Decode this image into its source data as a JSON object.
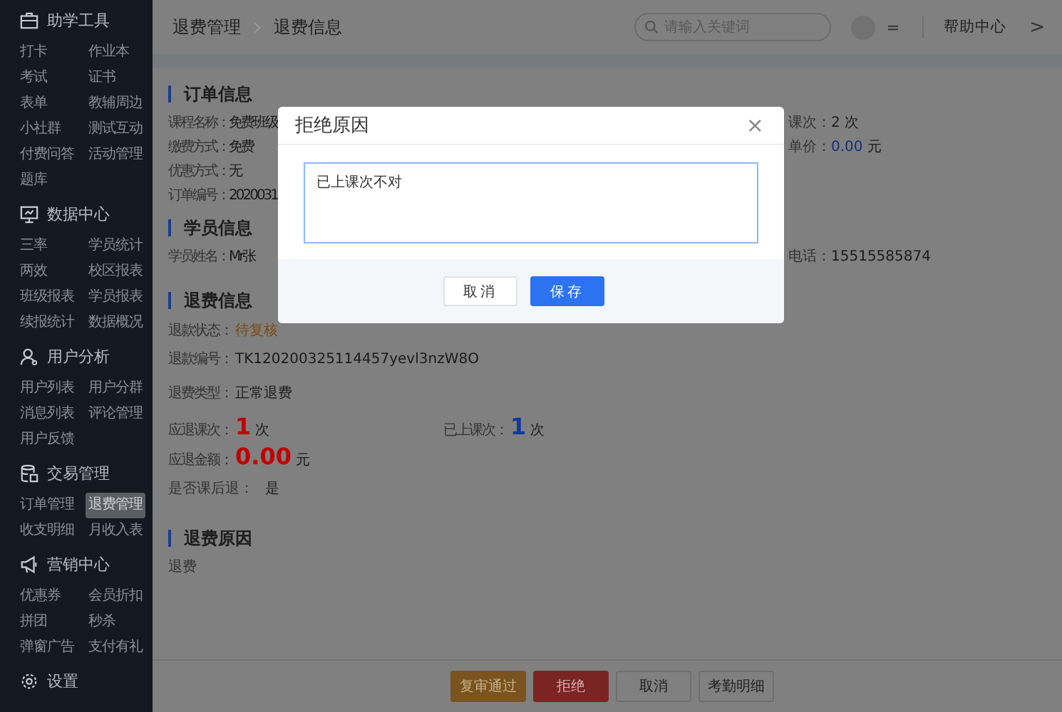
{
  "sidebar": {
    "groups": [
      {
        "title": "助学工具",
        "items": [
          {
            "label": "打卡",
            "selected": false
          },
          {
            "label": "作业本",
            "selected": false
          },
          {
            "label": "考试",
            "selected": false
          },
          {
            "label": "证书",
            "selected": false
          },
          {
            "label": "表单",
            "selected": false
          },
          {
            "label": "教辅周边",
            "selected": false
          },
          {
            "label": "小社群",
            "selected": false
          },
          {
            "label": "测试互动",
            "selected": false
          },
          {
            "label": "付费问答",
            "selected": false
          },
          {
            "label": "活动管理",
            "selected": false
          },
          {
            "label": "题库",
            "selected": false
          }
        ]
      },
      {
        "title": "数据中心",
        "items": [
          {
            "label": "三率",
            "selected": false
          },
          {
            "label": "学员统计",
            "selected": false
          },
          {
            "label": "两效",
            "selected": false
          },
          {
            "label": "校区报表",
            "selected": false
          },
          {
            "label": "班级报表",
            "selected": false
          },
          {
            "label": "学员报表",
            "selected": false
          },
          {
            "label": "续报统计",
            "selected": false
          },
          {
            "label": "数据概况",
            "selected": false
          }
        ]
      },
      {
        "title": "用户分析",
        "items": [
          {
            "label": "用户列表",
            "selected": false
          },
          {
            "label": "用户分群",
            "selected": false
          },
          {
            "label": "消息列表",
            "selected": false
          },
          {
            "label": "评论管理",
            "selected": false
          },
          {
            "label": "用户反馈",
            "selected": false
          }
        ]
      },
      {
        "title": "交易管理",
        "items": [
          {
            "label": "订单管理",
            "selected": false
          },
          {
            "label": "退费管理",
            "selected": true
          },
          {
            "label": "收支明细",
            "selected": false
          },
          {
            "label": "月收入表",
            "selected": false
          }
        ]
      },
      {
        "title": "营销中心",
        "items": [
          {
            "label": "优惠券",
            "selected": false
          },
          {
            "label": "会员折扣",
            "selected": false
          },
          {
            "label": "拼团",
            "selected": false
          },
          {
            "label": "秒杀",
            "selected": false
          },
          {
            "label": "弹窗广告",
            "selected": false
          },
          {
            "label": "支付有礼",
            "selected": false
          }
        ]
      },
      {
        "title": "设置"
      }
    ]
  },
  "header": {
    "breadcrumb": [
      "退费管理",
      "退费信息"
    ],
    "search": {
      "placeholder": "请输入关键词"
    },
    "menu_glyph": "=",
    "help": "帮助中心",
    "chevron": ">"
  },
  "order_info": {
    "title": "订单信息",
    "left": [
      {
        "label": "课程名称：",
        "value": "免费班级"
      },
      {
        "label": "缴费方式：",
        "value": "免费"
      },
      {
        "label": "优惠方式：",
        "value": " 无"
      },
      {
        "label": "订单编号：",
        "value": "2020031"
      }
    ],
    "right": [
      {
        "label": "课次：",
        "value": "2 次"
      },
      {
        "label": "单价：",
        "value": "0.00",
        "unit": "元"
      }
    ]
  },
  "student_info": {
    "title": "学员信息",
    "name": {
      "label": "学员姓名：",
      "value": "Mr张"
    },
    "phone": {
      "label": "电话：",
      "value": "15515585874"
    }
  },
  "refund_info": {
    "title": "退费信息",
    "status": {
      "label": "退款状态：",
      "value": "待复核"
    },
    "number": {
      "label": "退款编号：",
      "value": "TK120200325114457yevl3nzW8O"
    },
    "type": {
      "label": "退费类型：",
      "value": "正常退费"
    },
    "lessons_refund": {
      "label": "应退课次：",
      "value": "1",
      "unit": "次"
    },
    "lessons_taken": {
      "label": "已上课次：",
      "value": "1",
      "unit": "次"
    },
    "amount": {
      "label": "应退金额：",
      "value": "0.00",
      "unit": "元"
    },
    "after_class": {
      "label": "是否课后退：",
      "value": "是"
    }
  },
  "refund_reason": {
    "title": "退费原因",
    "text": "退费"
  },
  "actions": [
    "复审通过",
    "拒绝",
    "取消",
    "考勤明细"
  ],
  "dialog": {
    "title": "拒绝原因",
    "close": "×",
    "reason": "已上课次不对",
    "buttons": [
      "取消",
      "保存"
    ]
  }
}
